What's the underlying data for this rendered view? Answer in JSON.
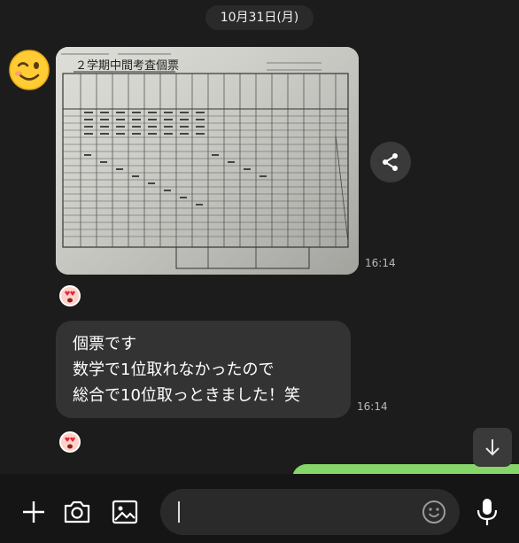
{
  "chat": {
    "date_separator": "10月31日(月)",
    "messages": [
      {
        "type": "image",
        "sender_avatar": "winking-face-emoji",
        "image_alt": "2学期中間考査個票",
        "time": "16:14",
        "reaction": "heart-eyes-sticker"
      },
      {
        "type": "text",
        "text": "個票です\n数学で1位取れなかったので\n総合で10位取っときました！笑",
        "time": "16:14",
        "reaction": "heart-eyes-sticker"
      }
    ]
  },
  "image_content": {
    "title": "２学期中間考査個票"
  },
  "toolbar": {
    "icons": [
      "plus-icon",
      "camera-icon",
      "gallery-icon",
      "emoji-icon",
      "microphone-icon"
    ]
  },
  "input": {
    "value": ""
  },
  "colors": {
    "background": "#1c1c1c",
    "bubble": "#333333",
    "sent_bubble": "#86d66a"
  }
}
